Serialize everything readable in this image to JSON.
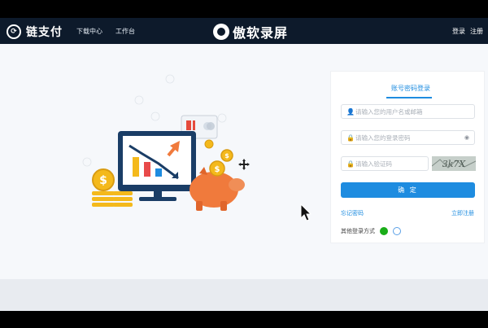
{
  "navbar": {
    "logo_text": "链支付",
    "links": [
      "下载中心",
      "工作台"
    ],
    "watermark_text": "傲软录屏",
    "login": "登录",
    "register": "注册"
  },
  "login_panel": {
    "tab_label": "账号密码登录",
    "username_placeholder": "请输入您的用户名或邮箱",
    "password_placeholder": "请输入您的登录密码",
    "captcha_placeholder": "请输入验证码",
    "captcha_text": "3k7X",
    "confirm_label": "确 定",
    "forgot_password": "忘记密码",
    "register_now": "立即注册",
    "other_login": "其他登录方式"
  },
  "colors": {
    "navbar_bg": "#0d1a2b",
    "accent": "#1e8ce0",
    "coin": "#f4b91c",
    "piggy": "#f07a3c",
    "monitor": "#1a3d66"
  },
  "icons": [
    "user-icon",
    "lock-icon",
    "eye-off-icon",
    "shield-icon",
    "wechat-icon",
    "cloud-icon",
    "move-cursor-icon",
    "arrow-cursor-icon"
  ]
}
